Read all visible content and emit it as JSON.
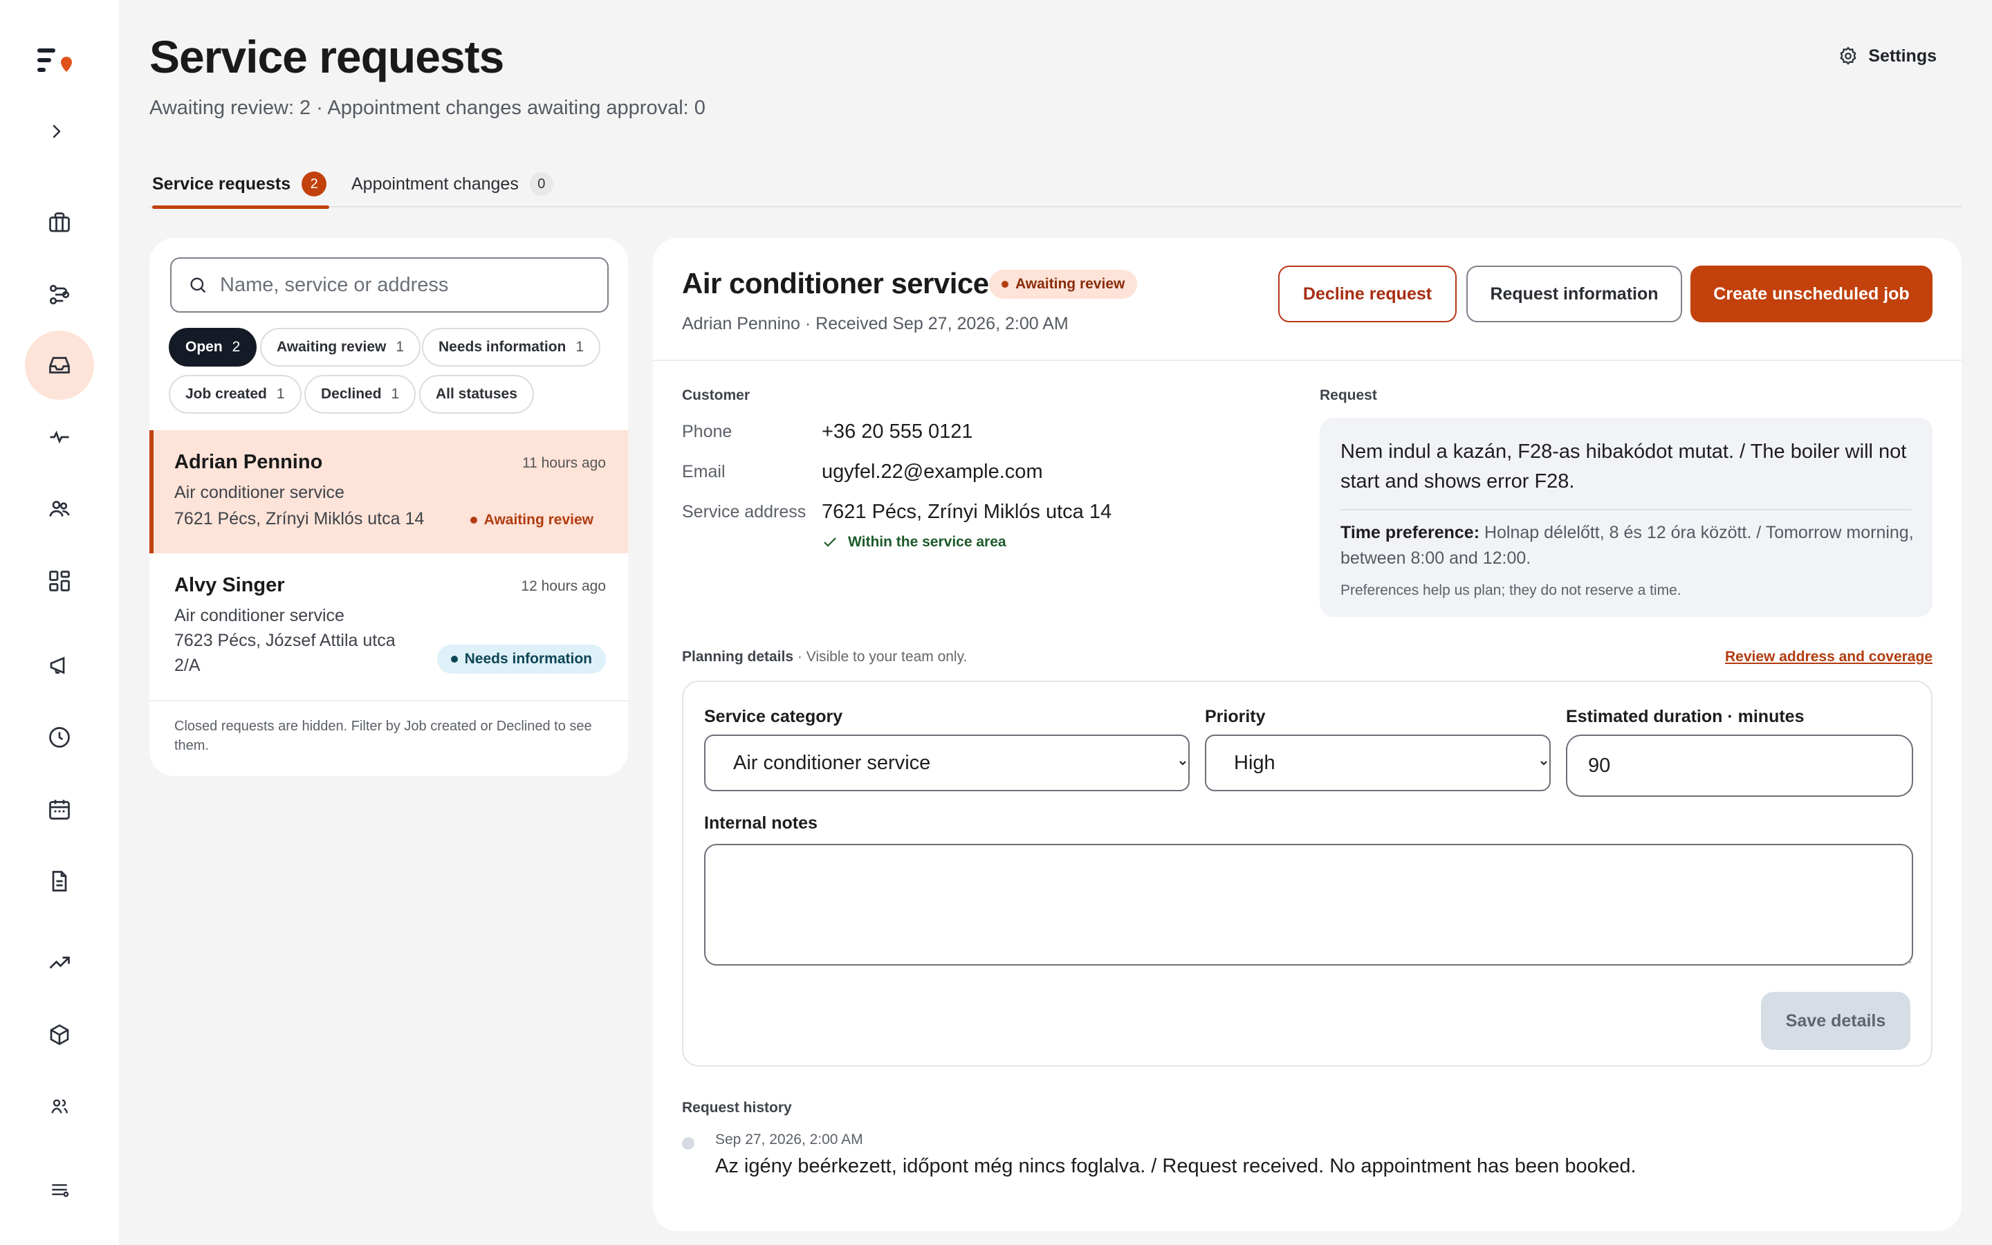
{
  "page": {
    "title": "Service requests",
    "subtitle": "Awaiting review: 2 · Appointment changes awaiting approval: 0",
    "settings_label": "Settings"
  },
  "sidebar": {
    "items": [
      {
        "icon": "briefcase-icon"
      },
      {
        "icon": "route-icon"
      },
      {
        "icon": "inbox-icon",
        "active": true
      },
      {
        "icon": "activity-icon"
      },
      {
        "icon": "team-icon"
      },
      {
        "icon": "dashboard-icon"
      },
      {
        "icon": "megaphone-icon"
      },
      {
        "icon": "clock-icon"
      },
      {
        "icon": "calendar-icon"
      },
      {
        "icon": "document-icon"
      },
      {
        "icon": "trending-up-icon"
      },
      {
        "icon": "box-icon"
      },
      {
        "icon": "users-icon"
      },
      {
        "icon": "menu-settings-icon"
      }
    ]
  },
  "tabs": [
    {
      "label": "Service requests",
      "count": "2",
      "active": true
    },
    {
      "label": "Appointment changes",
      "count": "0",
      "active": false
    }
  ],
  "list": {
    "search_placeholder": "Name, service or address",
    "filters": [
      {
        "label": "Open",
        "count": "2",
        "active": true
      },
      {
        "label": "Awaiting review",
        "count": "1"
      },
      {
        "label": "Needs information",
        "count": "1"
      },
      {
        "label": "Job created",
        "count": "1"
      },
      {
        "label": "Declined",
        "count": "1"
      },
      {
        "label": "All statuses",
        "count": ""
      }
    ],
    "requests": [
      {
        "name": "Adrian Pennino",
        "time": "11 hours ago",
        "service": "Air conditioner service",
        "address": "7621 Pécs, Zrínyi Miklós utca 14",
        "status": "Awaiting review"
      },
      {
        "name": "Alvy Singer",
        "time": "12 hours ago",
        "service": "Air conditioner service",
        "address_line1": "7623 Pécs, József Attila utca",
        "address_line2": "2/A",
        "status": "Needs information"
      }
    ],
    "note": "Closed requests are hidden. Filter by Job created or Declined to see them."
  },
  "detail": {
    "title": "Air conditioner service",
    "status": "Awaiting review",
    "meta": "Adrian Pennino · Received Sep 27, 2026, 2:00 AM",
    "buttons": {
      "decline": "Decline request",
      "info": "Request information",
      "create": "Create unscheduled job"
    },
    "customer": {
      "section_label": "Customer",
      "phone_label": "Phone",
      "phone": "+36 20 555 0121",
      "email_label": "Email",
      "email": "ugyfel.22@example.com",
      "address_label": "Service address",
      "address": "7621 Pécs, Zrínyi Miklós utca 14",
      "coverage": "Within the service area"
    },
    "request": {
      "section_label": "Request",
      "text": "Nem indul a kazán, F28-as hibakódot mutat. / The boiler will not start and shows error F28.",
      "time_pref_label": "Time preference:",
      "time_pref": "Holnap délelőtt, 8 és 12 óra között. / Tomorrow morning, between 8:00 and 12:00.",
      "pref_note": "Preferences help us plan; they do not reserve a time."
    },
    "planning": {
      "label": "Planning details",
      "label_note": "· Visible to your team only.",
      "review_link": "Review address and coverage",
      "category_label": "Service category",
      "category_value": "Air conditioner service",
      "priority_label": "Priority",
      "priority_value": "High",
      "duration_label": "Estimated duration · minutes",
      "duration_value": "90",
      "notes_label": "Internal notes",
      "notes_value": "",
      "save_label": "Save details"
    },
    "history": {
      "label": "Request history",
      "entries": [
        {
          "time": "Sep 27, 2026, 2:00 AM",
          "text": "Az igény beérkezett, időpont még nincs foglalva. / Request received. No appointment has been booked."
        }
      ]
    }
  },
  "colors": {
    "accent": "#c2410c",
    "selected_bg": "#fde3d8",
    "info_bg": "#dff1f8",
    "dark_chip": "#141a26"
  }
}
